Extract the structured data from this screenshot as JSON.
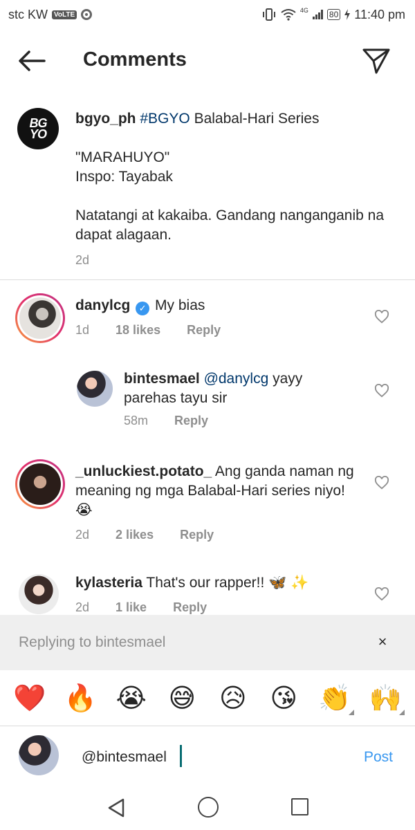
{
  "status_bar": {
    "carrier": "stc KW",
    "volte": "VoLTE",
    "network": "4G",
    "battery": "80",
    "time": "11:40 pm"
  },
  "header": {
    "title": "Comments"
  },
  "caption": {
    "avatar_text_1": "BG",
    "avatar_text_2": "YO",
    "username": "bgyo_ph",
    "hashtag": "#BGYO",
    "line1_rest": "Balabal-Hari Series",
    "line2": "\"MARAHUYO\"",
    "line3": "Inspo: Tayabak",
    "line4": "Natatangi at kakaiba. Gandang nanganganib na dapat alagaan.",
    "time": "2d"
  },
  "comments": [
    {
      "username": "danylcg",
      "text": "My bias",
      "time": "1d",
      "likes": "18 likes",
      "reply_label": "Reply",
      "verified": "✓"
    },
    {
      "username": "bintesmael",
      "mention": "@danylcg",
      "text": "yayy parehas tayu sir",
      "time": "58m",
      "reply_label": "Reply"
    },
    {
      "username": "_unluckiest.potato_",
      "text": "Ang ganda naman ng meaning ng mga Balabal-Hari series niyo! 😭",
      "time": "2d",
      "likes": "2 likes",
      "reply_label": "Reply"
    },
    {
      "username": "kylasteria",
      "text": "That's our rapper!! 🦋 ✨",
      "time": "2d",
      "likes": "1 like",
      "reply_label": "Reply"
    }
  ],
  "reply_bar": {
    "text": "Replying to bintesmael",
    "close": "×"
  },
  "emoji_bar": [
    "❤️",
    "🔥",
    "😭",
    "😅",
    "😥",
    "😘",
    "👏",
    "🙌"
  ],
  "composer": {
    "value": "@bintesmael",
    "post_label": "Post"
  },
  "icons": {
    "back": "arrow-left-icon",
    "send": "paper-plane-icon",
    "heart": "heart-outline-icon",
    "close": "close-icon"
  },
  "colors": {
    "link": "#00376b",
    "post": "#3897f0",
    "muted": "#8e8e8e",
    "verified": "#3897f0"
  }
}
